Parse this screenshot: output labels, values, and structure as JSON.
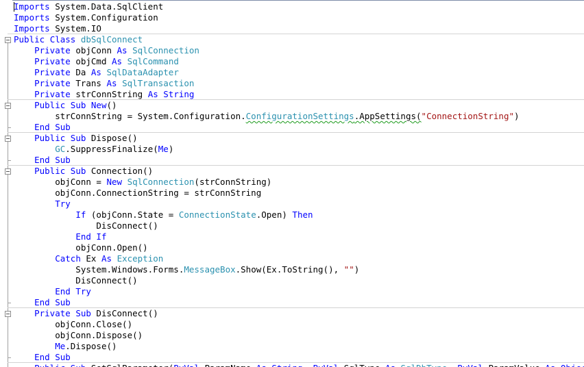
{
  "editor": {
    "colors": {
      "keyword": "#0000ff",
      "type": "#2b91af",
      "string": "#a31515",
      "text": "#000000"
    },
    "lines": [
      [
        {
          "t": "Imports",
          "c": "kw"
        },
        {
          "t": " System.Data.SqlClient"
        }
      ],
      [
        {
          "t": "Imports",
          "c": "kw"
        },
        {
          "t": " System.Configuration"
        }
      ],
      [
        {
          "t": "Imports",
          "c": "kw"
        },
        {
          "t": " System.IO"
        }
      ],
      [
        {
          "t": "Public",
          "c": "kw"
        },
        {
          "t": " "
        },
        {
          "t": "Class",
          "c": "kw"
        },
        {
          "t": " "
        },
        {
          "t": "dbSqlConnect",
          "c": "ty"
        }
      ],
      [
        {
          "t": "    "
        },
        {
          "t": "Private",
          "c": "kw"
        },
        {
          "t": " objConn "
        },
        {
          "t": "As",
          "c": "kw"
        },
        {
          "t": " "
        },
        {
          "t": "SqlConnection",
          "c": "ty"
        }
      ],
      [
        {
          "t": "    "
        },
        {
          "t": "Private",
          "c": "kw"
        },
        {
          "t": " objCmd "
        },
        {
          "t": "As",
          "c": "kw"
        },
        {
          "t": " "
        },
        {
          "t": "SqlCommand",
          "c": "ty"
        }
      ],
      [
        {
          "t": "    "
        },
        {
          "t": "Private",
          "c": "kw"
        },
        {
          "t": " Da "
        },
        {
          "t": "As",
          "c": "kw"
        },
        {
          "t": " "
        },
        {
          "t": "SqlDataAdapter",
          "c": "ty"
        }
      ],
      [
        {
          "t": "    "
        },
        {
          "t": "Private",
          "c": "kw"
        },
        {
          "t": " Trans "
        },
        {
          "t": "As",
          "c": "kw"
        },
        {
          "t": " "
        },
        {
          "t": "SqlTransaction",
          "c": "ty"
        }
      ],
      [
        {
          "t": "    "
        },
        {
          "t": "Private",
          "c": "kw"
        },
        {
          "t": " strConnString "
        },
        {
          "t": "As",
          "c": "kw"
        },
        {
          "t": " "
        },
        {
          "t": "String",
          "c": "kw"
        }
      ],
      [
        {
          "t": "    "
        },
        {
          "t": "Public",
          "c": "kw"
        },
        {
          "t": " "
        },
        {
          "t": "Sub",
          "c": "kw"
        },
        {
          "t": " "
        },
        {
          "t": "New",
          "c": "kw"
        },
        {
          "t": "()"
        }
      ],
      [
        {
          "t": "        strConnString = System.Configuration."
        },
        {
          "t": "ConfigurationSettings",
          "c": "ty",
          "s": 1
        },
        {
          "t": ".AppSettings(",
          "s": 1
        },
        {
          "t": "\"ConnectionString\"",
          "c": "str"
        },
        {
          "t": ")"
        }
      ],
      [
        {
          "t": "    "
        },
        {
          "t": "End",
          "c": "kw"
        },
        {
          "t": " "
        },
        {
          "t": "Sub",
          "c": "kw"
        }
      ],
      [
        {
          "t": "    "
        },
        {
          "t": "Public",
          "c": "kw"
        },
        {
          "t": " "
        },
        {
          "t": "Sub",
          "c": "kw"
        },
        {
          "t": " Dispose()"
        }
      ],
      [
        {
          "t": "        "
        },
        {
          "t": "GC",
          "c": "ty"
        },
        {
          "t": ".SuppressFinalize("
        },
        {
          "t": "Me",
          "c": "kw"
        },
        {
          "t": ")"
        }
      ],
      [
        {
          "t": "    "
        },
        {
          "t": "End",
          "c": "kw"
        },
        {
          "t": " "
        },
        {
          "t": "Sub",
          "c": "kw"
        }
      ],
      [
        {
          "t": "    "
        },
        {
          "t": "Public",
          "c": "kw"
        },
        {
          "t": " "
        },
        {
          "t": "Sub",
          "c": "kw"
        },
        {
          "t": " Connection()"
        }
      ],
      [
        {
          "t": "        objConn = "
        },
        {
          "t": "New",
          "c": "kw"
        },
        {
          "t": " "
        },
        {
          "t": "SqlConnection",
          "c": "ty"
        },
        {
          "t": "(strConnString)"
        }
      ],
      [
        {
          "t": "        objConn.ConnectionString = strConnString"
        }
      ],
      [
        {
          "t": "        "
        },
        {
          "t": "Try",
          "c": "kw"
        }
      ],
      [
        {
          "t": "            "
        },
        {
          "t": "If",
          "c": "kw"
        },
        {
          "t": " (objConn.State = "
        },
        {
          "t": "ConnectionState",
          "c": "ty"
        },
        {
          "t": ".Open) "
        },
        {
          "t": "Then",
          "c": "kw"
        }
      ],
      [
        {
          "t": "                DisConnect()"
        }
      ],
      [
        {
          "t": "            "
        },
        {
          "t": "End",
          "c": "kw"
        },
        {
          "t": " "
        },
        {
          "t": "If",
          "c": "kw"
        }
      ],
      [
        {
          "t": "            objConn.Open()"
        }
      ],
      [
        {
          "t": "        "
        },
        {
          "t": "Catch",
          "c": "kw"
        },
        {
          "t": " Ex "
        },
        {
          "t": "As",
          "c": "kw"
        },
        {
          "t": " "
        },
        {
          "t": "Exception",
          "c": "ty"
        }
      ],
      [
        {
          "t": "            System.Windows.Forms."
        },
        {
          "t": "MessageBox",
          "c": "ty"
        },
        {
          "t": ".Show(Ex.ToString(), "
        },
        {
          "t": "\"\"",
          "c": "str"
        },
        {
          "t": ")"
        }
      ],
      [
        {
          "t": "            DisConnect()"
        }
      ],
      [
        {
          "t": "        "
        },
        {
          "t": "End",
          "c": "kw"
        },
        {
          "t": " "
        },
        {
          "t": "Try",
          "c": "kw"
        }
      ],
      [
        {
          "t": "    "
        },
        {
          "t": "End",
          "c": "kw"
        },
        {
          "t": " "
        },
        {
          "t": "Sub",
          "c": "kw"
        }
      ],
      [
        {
          "t": "    "
        },
        {
          "t": "Private",
          "c": "kw"
        },
        {
          "t": " "
        },
        {
          "t": "Sub",
          "c": "kw"
        },
        {
          "t": " DisConnect()"
        }
      ],
      [
        {
          "t": "        objConn.Close()"
        }
      ],
      [
        {
          "t": "        objConn.Dispose()"
        }
      ],
      [
        {
          "t": "        "
        },
        {
          "t": "Me",
          "c": "kw"
        },
        {
          "t": ".Dispose()"
        }
      ],
      [
        {
          "t": "    "
        },
        {
          "t": "End",
          "c": "kw"
        },
        {
          "t": " "
        },
        {
          "t": "Sub",
          "c": "kw"
        }
      ],
      [
        {
          "t": "    "
        },
        {
          "t": "Public",
          "c": "kw"
        },
        {
          "t": " "
        },
        {
          "t": "Sub",
          "c": "kw"
        },
        {
          "t": " SetSqlParameter("
        },
        {
          "t": "ByVal",
          "c": "kw"
        },
        {
          "t": " ParamName "
        },
        {
          "t": "As",
          "c": "kw"
        },
        {
          "t": " "
        },
        {
          "t": "String",
          "c": "kw"
        },
        {
          "t": ", "
        },
        {
          "t": "ByVal",
          "c": "kw"
        },
        {
          "t": " SqlType "
        },
        {
          "t": "As",
          "c": "kw"
        },
        {
          "t": " "
        },
        {
          "t": "SqlDbType",
          "c": "ty"
        },
        {
          "t": ", "
        },
        {
          "t": "ByVal",
          "c": "kw"
        },
        {
          "t": " ParamValue "
        },
        {
          "t": "As",
          "c": "kw"
        },
        {
          "t": " "
        },
        {
          "t": "Object",
          "c": "kw"
        },
        {
          "t": ")"
        }
      ]
    ],
    "separator_lines": [
      3,
      9,
      12,
      15,
      28,
      33
    ],
    "fold_regions": [
      {
        "start": 3,
        "end": 34
      },
      {
        "start": 9,
        "end": 11
      },
      {
        "start": 12,
        "end": 14
      },
      {
        "start": 15,
        "end": 27
      },
      {
        "start": 28,
        "end": 32
      }
    ]
  }
}
